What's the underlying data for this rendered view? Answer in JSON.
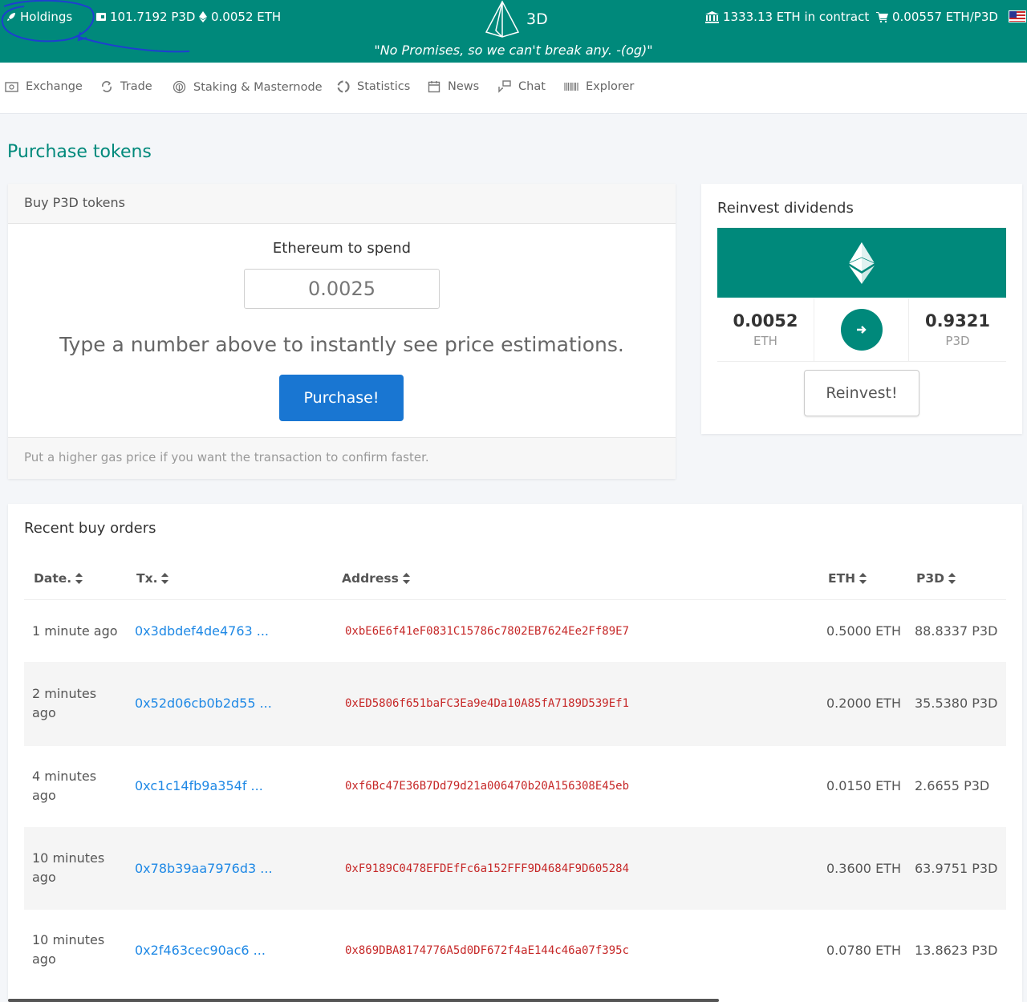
{
  "header": {
    "holdings_label": "Holdings",
    "p3d_balance": "101.7192 P3D",
    "eth_balance": "0.0052 ETH",
    "brand": "3D",
    "contract_eth": "1333.13 ETH in contract",
    "price": "0.00557 ETH/P3D",
    "motto": "\"No Promises, so we can't break any. -(og)\""
  },
  "nav": {
    "exchange": "Exchange",
    "trade": "Trade",
    "staking": "Staking & Masternode",
    "statistics": "Statistics",
    "news": "News",
    "chat": "Chat",
    "explorer": "Explorer"
  },
  "page_title": "Purchase tokens",
  "buy": {
    "header": "Buy P3D tokens",
    "eth_label": "Ethereum to spend",
    "eth_value": "0.0025",
    "hint": "Type a number above to instantly see price estimations.",
    "button": "Purchase!",
    "footer": "Put a higher gas price if you want the transaction to confirm faster."
  },
  "reinvest": {
    "title": "Reinvest dividends",
    "eth_value": "0.0052",
    "eth_unit": "ETH",
    "p3d_value": "0.9321",
    "p3d_unit": "P3D",
    "button": "Reinvest!"
  },
  "orders": {
    "title": "Recent buy orders",
    "columns": {
      "date": "Date.",
      "tx": "Tx.",
      "address": "Address",
      "eth": "ETH",
      "p3d": "P3D"
    },
    "rows": [
      {
        "date": "1 minute ago",
        "tx": "0x3dbdef4de4763 ...",
        "address": "0xbE6E6f41eF0831C15786c7802EB7624Ee2Ff89E7",
        "eth": "0.5000 ETH",
        "p3d": "88.8337 P3D"
      },
      {
        "date": "2 minutes ago",
        "tx": "0x52d06cb0b2d55 ...",
        "address": "0xED5806f651baFC3Ea9e4Da10A85fA7189D539Ef1",
        "eth": "0.2000 ETH",
        "p3d": "35.5380 P3D"
      },
      {
        "date": "4 minutes ago",
        "tx": "0xc1c14fb9a354f ...",
        "address": "0xf6Bc47E36B7Dd79d21a006470b20A156308E45eb",
        "eth": "0.0150 ETH",
        "p3d": "2.6655 P3D"
      },
      {
        "date": "10 minutes ago",
        "tx": "0x78b39aa7976d3 ...",
        "address": "0xF9189C0478EFDEfFc6a152FFF9D4684F9D605284",
        "eth": "0.3600 ETH",
        "p3d": "63.9751 P3D"
      },
      {
        "date": "10 minutes ago",
        "tx": "0x2f463cec90ac6 ...",
        "address": "0x869DBA8174776A5d0DF672f4aE144c46a07f395c",
        "eth": "0.0780 ETH",
        "p3d": "13.8623 P3D"
      }
    ]
  },
  "colors": {
    "brand": "#00897b",
    "button_primary": "#1976d2",
    "link": "#1e88e5",
    "address": "#c62828"
  }
}
